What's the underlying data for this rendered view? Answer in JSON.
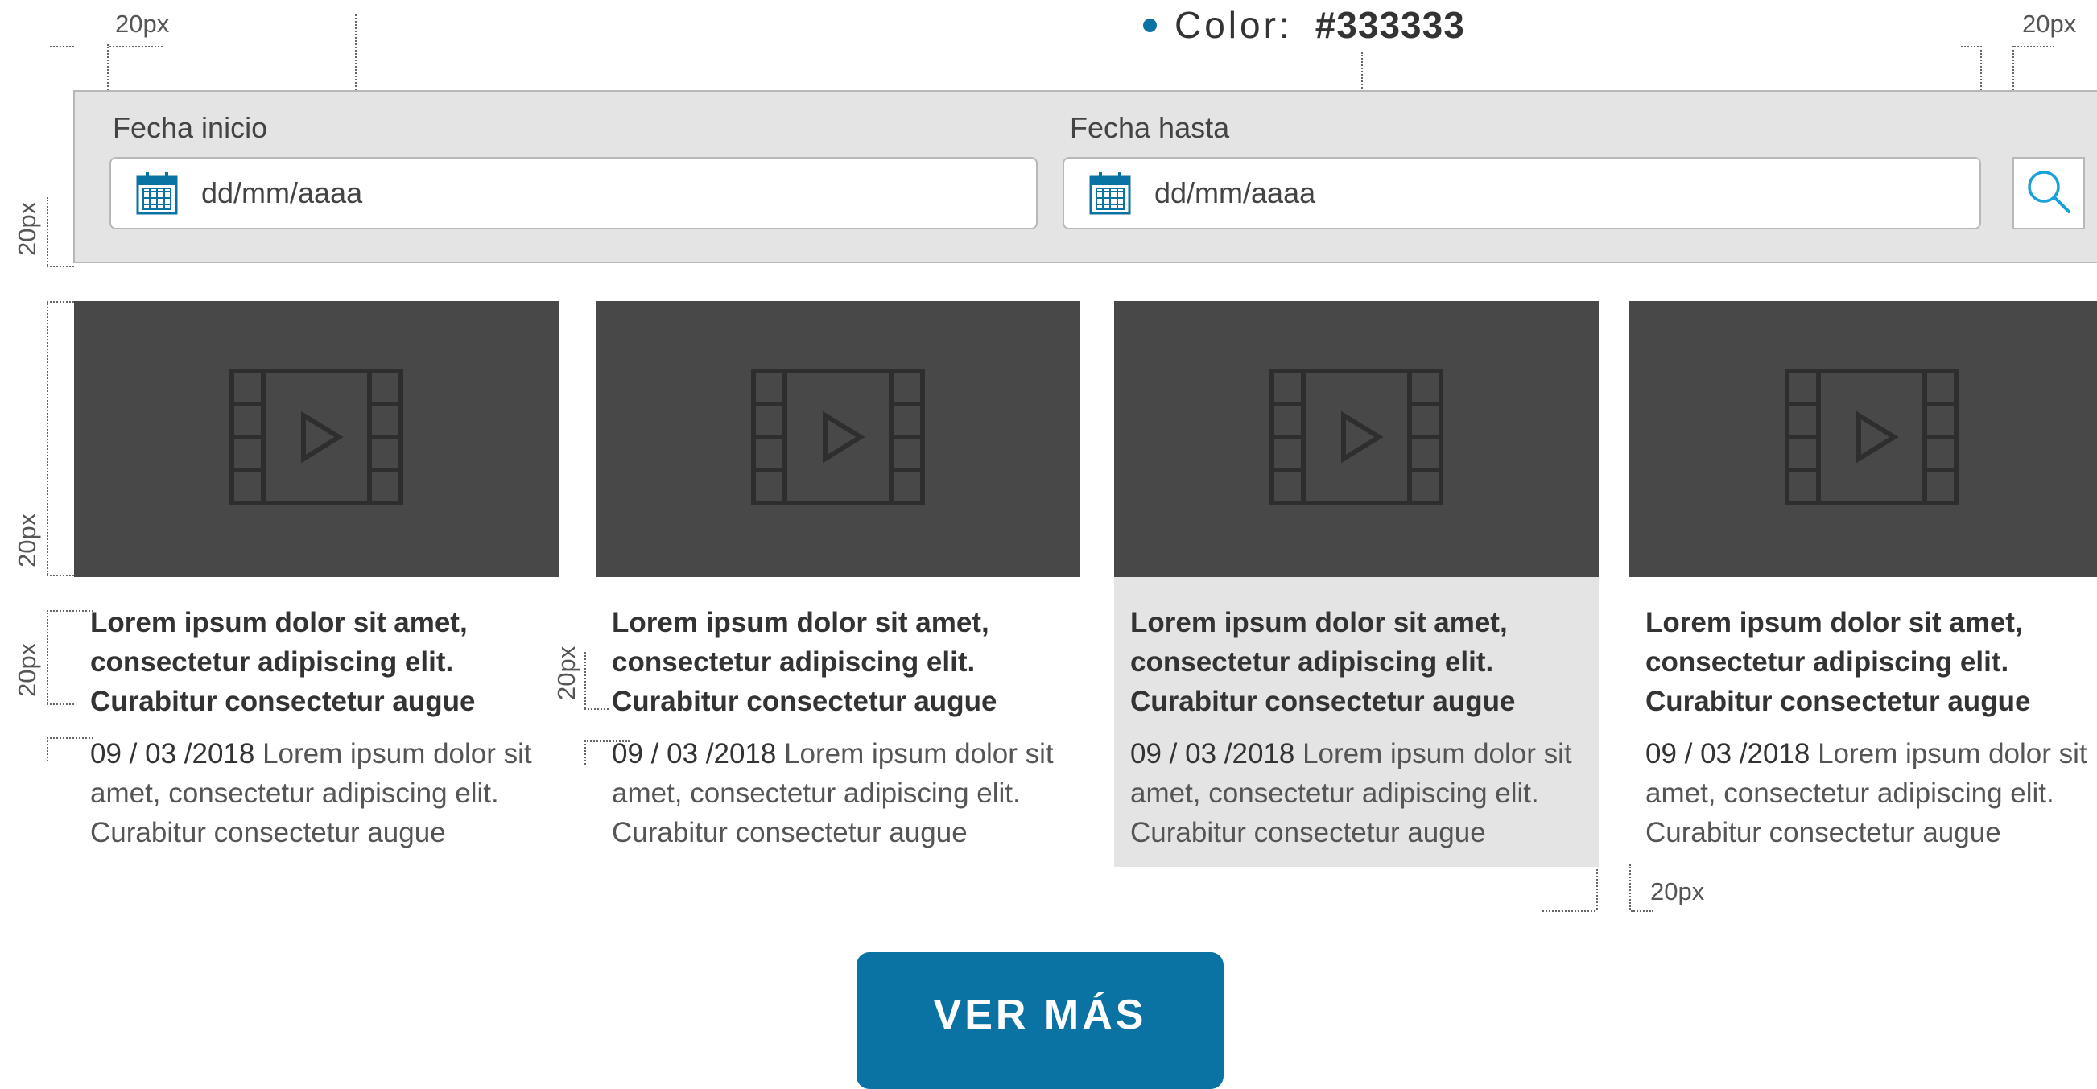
{
  "annotations": {
    "top_left_margin": "20px",
    "top_right_margin": "20px",
    "filter_bottom_margin": "20px",
    "thumb_gap": "20px",
    "title_gap": "20px",
    "title_gap_2": "20px",
    "card_gap": "20px"
  },
  "color_spec": {
    "label": "Color:",
    "value": "#333333",
    "bullet_color": "#0b73a3"
  },
  "filters": {
    "start_label": "Fecha inicio",
    "start_placeholder": "dd/mm/aaaa",
    "end_label": "Fecha hasta",
    "end_placeholder": "dd/mm/aaaa",
    "search_icon": "search-icon",
    "calendar_icon": "calendar-icon"
  },
  "cards": [
    {
      "title": "Lorem ipsum dolor sit amet, consectetur adipiscing elit. Curabitur consectetur augue",
      "date": "09 / 03 /2018",
      "description": "Lorem ipsum dolor sit amet, consectetur adipiscing elit. Curabitur consectetur augue",
      "highlighted": false
    },
    {
      "title": "Lorem ipsum dolor sit amet, consectetur adipiscing elit. Curabitur consectetur augue",
      "date": "09 / 03 /2018",
      "description": "Lorem ipsum dolor sit amet, consectetur adipiscing elit. Curabitur consectetur augue",
      "highlighted": false
    },
    {
      "title": "Lorem ipsum dolor sit amet, consectetur adipiscing elit. Curabitur consectetur augue",
      "date": "09 / 03 /2018",
      "description": "Lorem ipsum dolor sit amet, consectetur adipiscing elit. Curabitur consectetur augue",
      "highlighted": true
    },
    {
      "title": "Lorem ipsum dolor sit amet, consectetur adipiscing elit. Curabitur consectetur augue",
      "date": "09 / 03 /2018",
      "description": "Lorem ipsum dolor sit amet, consectetur adipiscing elit. Curabitur consectetur augue",
      "highlighted": false
    }
  ],
  "video_icon": "film-play-icon",
  "more_button": {
    "label": "VER MÁS"
  },
  "colors": {
    "accent": "#0b73a3",
    "thumb_bg": "#484848",
    "filter_bg": "#e4e4e4",
    "text": "#333333"
  }
}
